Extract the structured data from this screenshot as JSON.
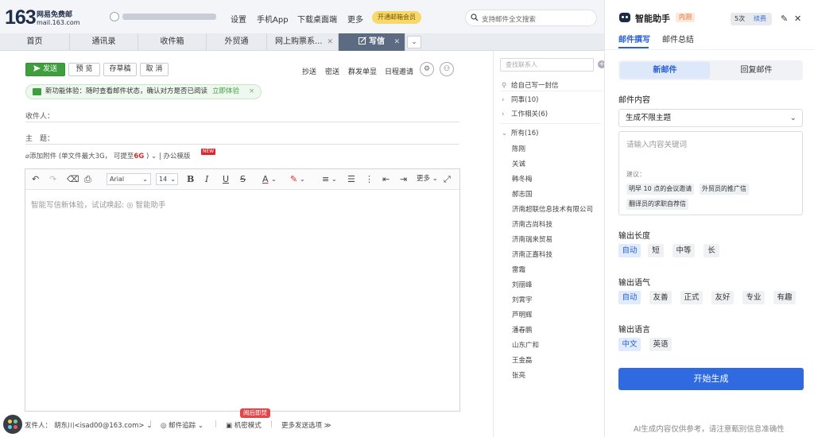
{
  "logo": {
    "number": "163",
    "line1": "网易免费邮",
    "line2": "mail.163.com"
  },
  "topnav": {
    "settings": "设置",
    "mobile_app": "手机App",
    "download_client": "下载桌面端",
    "more": "更多",
    "vip": "开通邮箱会员"
  },
  "search": {
    "placeholder": "支持邮件全文搜索"
  },
  "tabs": [
    {
      "label": "首页"
    },
    {
      "label": "通讯录"
    },
    {
      "label": "收件箱"
    },
    {
      "label": "外贸通"
    },
    {
      "label": "网上购票系..."
    },
    {
      "label": "写信",
      "active": true
    }
  ],
  "toolbar": {
    "send": "发送",
    "preview": "预 览",
    "save_draft": "存草稿",
    "cancel": "取 消",
    "cc": "抄送",
    "bcc": "密送",
    "group_send": "群发单显",
    "schedule_invite": "日程邀请"
  },
  "banner": {
    "text": "新功能体验：随时查看邮件状态，确认对方是否已阅读",
    "link": "立即体验",
    "close": "×"
  },
  "fields": {
    "to_label": "收件人：",
    "subject_label": "主　题："
  },
  "attach": {
    "add": "添加附件",
    "limit": "(单文件最大3G，",
    "upgrade_prefix": "可提至",
    "upgrade_value": "6G",
    "upgrade_suffix": ")",
    "office_template": "办公模版",
    "new_tag": "NEW"
  },
  "editor": {
    "font": "Arial",
    "size": "14",
    "more": "更多",
    "placeholder": "智能写信新体验，试试唤起:  ◎ 智能助手"
  },
  "bottom": {
    "sender_label": "发件人：",
    "sender": "胡东川<isad00@163.com>",
    "tracking": "邮件追踪",
    "confidential": "机密模式",
    "burn_tag": "阅后即焚",
    "more_options": "更多发送选项"
  },
  "contacts": {
    "search_placeholder": "查找联系人",
    "self": "给自己写一封信",
    "groups": [
      {
        "label": "同事(10)"
      },
      {
        "label": "工作相关(6)"
      },
      {
        "label": "所有(16)"
      }
    ],
    "people": [
      "陈刚",
      "关诚",
      "韩冬梅",
      "郝志国",
      "济南超联信息技术有限公司",
      "济南古尚科技",
      "济南瑞来贸易",
      "济南正嘉科技",
      "雷霜",
      "刘丽峰",
      "刘霄宇",
      "芦明辉",
      "潘春鹏",
      "山东广和",
      "王金磊",
      "张亮"
    ]
  },
  "assistant": {
    "title": "智能助手",
    "badge": "内测",
    "quota": "5次",
    "renew": "续费",
    "tabs": [
      {
        "label": "邮件撰写",
        "active": true
      },
      {
        "label": "邮件总结"
      }
    ],
    "segments": [
      {
        "label": "新邮件",
        "active": true
      },
      {
        "label": "回复邮件"
      }
    ],
    "content_label": "邮件内容",
    "type_select": "生成不限主题",
    "keyword_placeholder": "请输入内容关键词",
    "suggest_label": "建议：",
    "suggestions": [
      "明早 10 点的会议邀请",
      "外贸员的推广信",
      "翻译员的求职自荐信"
    ],
    "length_label": "输出长度",
    "length_options": [
      "自动",
      "短",
      "中等",
      "长"
    ],
    "tone_label": "输出语气",
    "tone_options": [
      "自动",
      "友善",
      "正式",
      "友好",
      "专业",
      "有趣"
    ],
    "lang_label": "输出语言",
    "lang_options": [
      "中文",
      "英语"
    ],
    "generate": "开始生成",
    "disclaimer": "AI生成内容仅供参考，请注意甄别信息准确性"
  },
  "colors": {
    "primary_blue": "#2f6ae0",
    "send_green": "#3f9e3e",
    "active_tab": "#5c6b82",
    "alert_red": "#e0262a"
  }
}
